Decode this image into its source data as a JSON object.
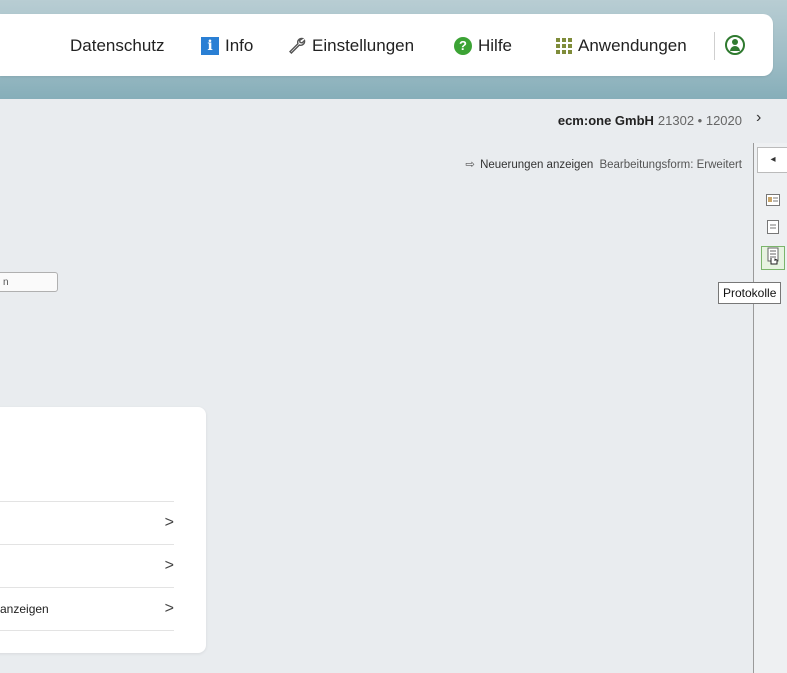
{
  "header": {
    "items": [
      {
        "label": "Datenschutz",
        "icon": ""
      },
      {
        "label": "Info",
        "icon": "info-icon"
      },
      {
        "label": "Einstellungen",
        "icon": "wrench-icon"
      },
      {
        "label": "Hilfe",
        "icon": "help-icon"
      },
      {
        "label": "Anwendungen",
        "icon": "apps-grid-icon"
      }
    ],
    "info_glyph": "i",
    "help_glyph": "?",
    "user_icon": "user-icon"
  },
  "tenant": {
    "name": "ecm:one GmbH",
    "ids": "21302 • 12020",
    "arrow": "›"
  },
  "news": {
    "arrow": "⇨",
    "link": "Neuerungen anzeigen",
    "mode": "Bearbeitungsform: Erweitert"
  },
  "sidebar": {
    "toggle": "◂",
    "tooltip": "Protokolle"
  },
  "input_stub": {
    "text": "n"
  },
  "card": {
    "rows": [
      {
        "label": "",
        "chevron": ">"
      },
      {
        "label": "",
        "chevron": ">"
      },
      {
        "label": "anzeigen",
        "chevron": ">"
      }
    ]
  },
  "colors": {
    "header_gradient_top": "#b8cdd3",
    "header_gradient_bottom": "#86aeb9",
    "page_bg": "#e9ecef",
    "info_blue": "#2a7fd4",
    "help_green": "#3ca335",
    "active_green": "#7bb56b"
  }
}
